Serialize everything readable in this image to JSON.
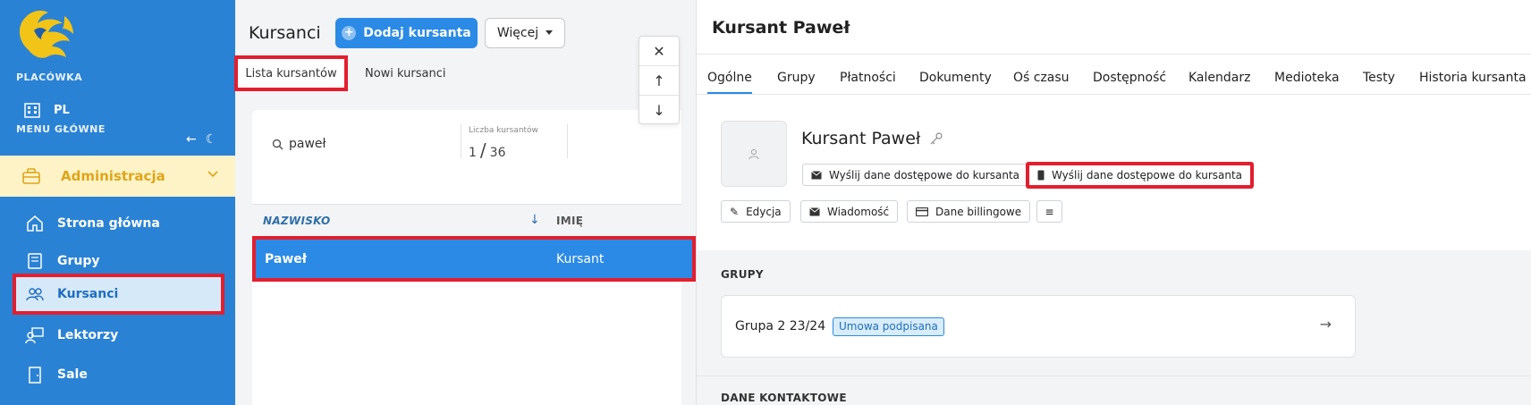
{
  "sidebar": {
    "placowka_heading": "PLACÓWKA",
    "placowka_value": "PL",
    "menu_heading": "MENU GŁÓWNE",
    "admin_label": "Administracja",
    "items": [
      {
        "label": "Strona główna",
        "icon": "home-icon"
      },
      {
        "label": "Grupy",
        "icon": "book-icon"
      },
      {
        "label": "Kursanci",
        "icon": "users-icon",
        "active": true
      },
      {
        "label": "Lektorzy",
        "icon": "teacher-icon"
      },
      {
        "label": "Sale",
        "icon": "door-icon"
      }
    ]
  },
  "students": {
    "title": "Kursanci",
    "add_button": "Dodaj kursanta",
    "more_button": "Więcej",
    "tabs": [
      "Lista kursantów",
      "Nowi kursanci"
    ],
    "search_value": "paweł",
    "count_label": "Liczba kursantów",
    "count_current": "1",
    "count_total": "36",
    "columns": [
      "NAZWISKO",
      "IMIĘ"
    ],
    "rows": [
      {
        "surname": "Paweł",
        "name": "Kursant"
      }
    ]
  },
  "detail": {
    "title": "Kursant Paweł",
    "tabs": [
      "Ogólne",
      "Grupy",
      "Płatności",
      "Dokumenty",
      "Oś czasu",
      "Dostępność",
      "Kalendarz",
      "Medioteka",
      "Testy",
      "Historia kursanta"
    ],
    "name": "Kursant Paweł",
    "send_email_button": "Wyślij dane dostępowe do kursanta",
    "send_sms_button": "Wyślij dane dostępowe do kursanta",
    "edit_button": "Edycja",
    "message_button": "Wiadomość",
    "billing_button": "Dane billingowe",
    "groups_heading": "GRUPY",
    "group_name": "Grupa 2 23/24",
    "group_badge": "Umowa podpisana",
    "contact_heading": "DANE KONTAKTOWE"
  },
  "colors": {
    "sidebar_bg": "#2a82d4",
    "accent": "#2a8ae6",
    "admin_bg": "#fdf3c6",
    "admin_text": "#e0a51a",
    "highlight": "#e31e2e"
  }
}
